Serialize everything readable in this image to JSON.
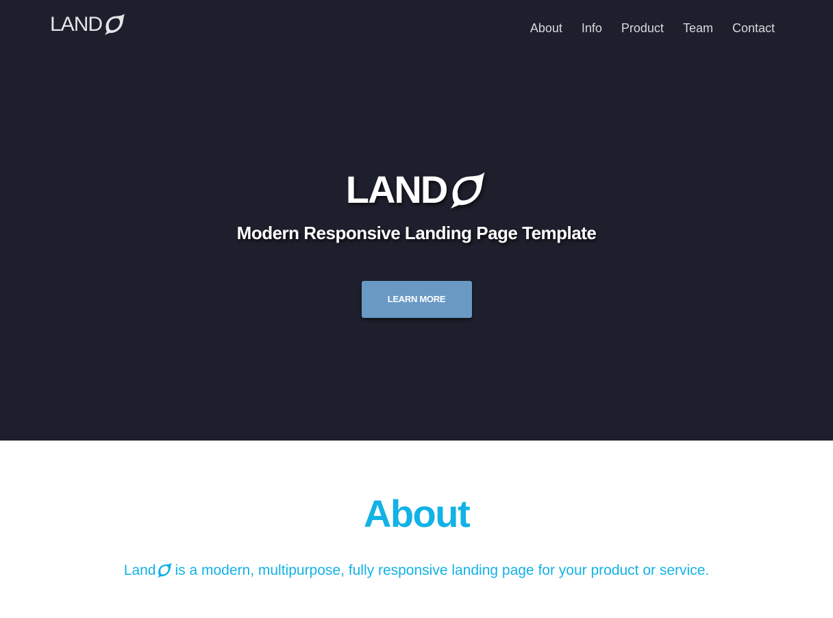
{
  "nav": {
    "logo_text": "LAND",
    "links": [
      "About",
      "Info",
      "Product",
      "Team",
      "Contact"
    ]
  },
  "hero": {
    "logo_text": "LAND",
    "subtitle": "Modern Responsive Landing Page Template",
    "button_label": "LEARN MORE"
  },
  "about": {
    "title": "About",
    "brand_text": "Land",
    "description": "is a modern, multipurpose, fully responsive landing page for your product or service."
  },
  "colors": {
    "hero_background": "#1e1f2c",
    "button": "#6a9ac4",
    "accent": "#12b2e6",
    "nav_text": "#d8d8dd"
  },
  "icons": [
    "logo-swoosh-o-icon"
  ]
}
